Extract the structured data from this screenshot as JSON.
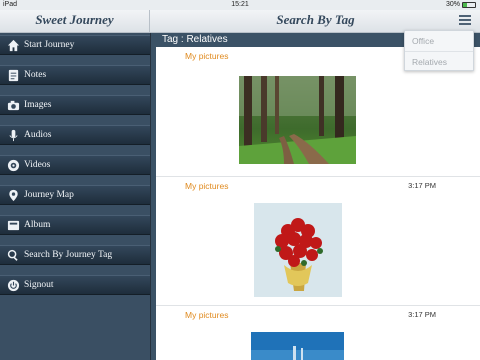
{
  "status_bar": {
    "device": "iPad",
    "time": "15:21",
    "battery": "30%",
    "battery_level": 0.3
  },
  "header": {
    "app_title": "Sweet Journey",
    "page_title": "Search By Tag",
    "menu_icon": "hamburger-menu-icon"
  },
  "sidebar": {
    "items": [
      {
        "label": "Start Journey",
        "icon": "home-icon"
      },
      {
        "label": "Notes",
        "icon": "notes-icon"
      },
      {
        "label": "Images",
        "icon": "camera-icon"
      },
      {
        "label": "Audios",
        "icon": "microphone-icon"
      },
      {
        "label": "Videos",
        "icon": "video-icon"
      },
      {
        "label": "Journey Map",
        "icon": "map-pin-icon"
      },
      {
        "label": "Album",
        "icon": "album-icon"
      },
      {
        "label": "Search By Journey Tag",
        "icon": "search-icon"
      },
      {
        "label": "Signout",
        "icon": "power-icon"
      }
    ]
  },
  "content": {
    "tag_header": "Tag : Relatives",
    "entries": [
      {
        "title": "My pictures",
        "time": "",
        "image": "forest-path-photo"
      },
      {
        "title": "My pictures",
        "time": "3:17 PM",
        "image": "red-roses-bouquet-photo"
      },
      {
        "title": "My pictures",
        "time": "3:17 PM",
        "image": "blue-sky-photo"
      }
    ]
  },
  "tag_dropdown": {
    "options": [
      "Office",
      "Relatives"
    ]
  },
  "colors": {
    "accent": "#e08a1e",
    "sidebar_bg": "#3a4f63",
    "header_text": "#34485c"
  }
}
